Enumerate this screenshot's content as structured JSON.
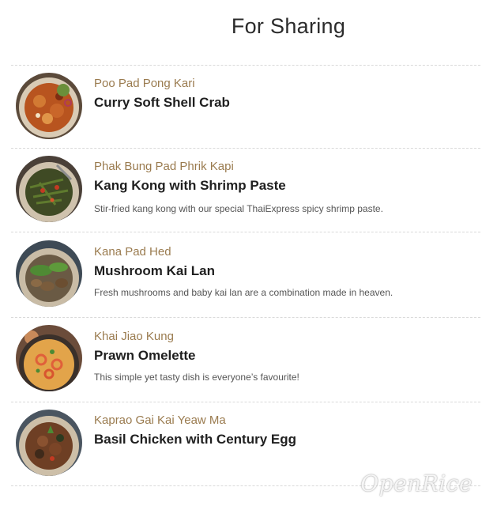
{
  "section": {
    "title": "For Sharing"
  },
  "items": [
    {
      "thai_name": "Poo Pad Pong Kari",
      "name": "Curry Soft Shell Crab",
      "description": "",
      "image": "curry-crab-dish"
    },
    {
      "thai_name": "Phak Bung Pad Phrik Kapi",
      "name": "Kang Kong with Shrimp Paste",
      "description": "Stir-fried kang kong with our special ThaiExpress spicy shrimp paste.",
      "image": "kang-kong-dish"
    },
    {
      "thai_name": "Kana Pad Hed",
      "name": "Mushroom Kai Lan",
      "description": "Fresh mushrooms and baby kai lan are a combination made in heaven.",
      "image": "mushroom-kai-lan-dish"
    },
    {
      "thai_name": "Khai Jiao Kung",
      "name": "Prawn Omelette",
      "description": "This simple yet tasty dish is everyone’s favourite!",
      "image": "prawn-omelette-dish"
    },
    {
      "thai_name": "Kaprao Gai Kai Yeaw Ma",
      "name": "Basil Chicken with Century Egg",
      "description": "",
      "image": "basil-chicken-dish"
    }
  ],
  "watermark": "OpenRice",
  "colors": {
    "thai_name": "#9a7b4f",
    "name": "#1f1f1f",
    "divider": "#d9d9d9"
  }
}
